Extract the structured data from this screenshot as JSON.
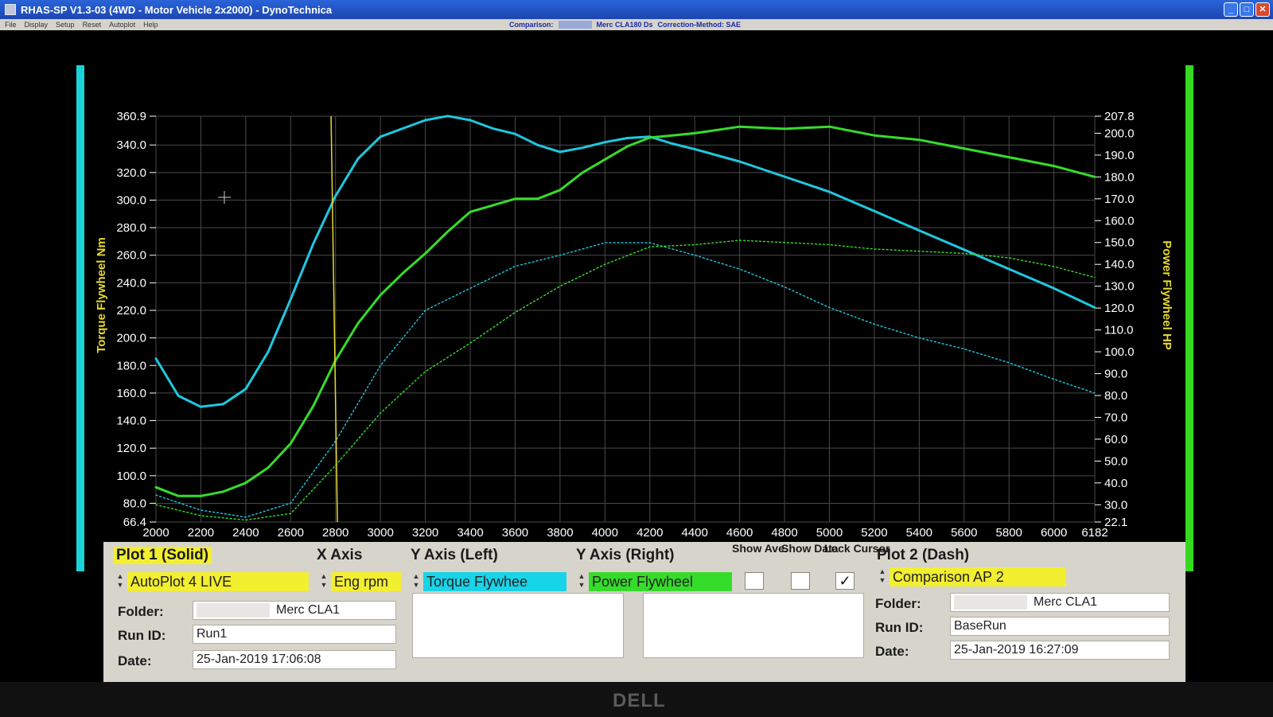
{
  "window": {
    "title": "RHAS-SP V1.3-03  (4WD - Motor Vehicle 2x2000) - DynoTechnica",
    "buttons": {
      "minimize": "_",
      "maximize": "□",
      "close": "✕"
    }
  },
  "menu": {
    "items": [
      "File",
      "Display",
      "Setup",
      "Reset",
      "Autoplot",
      "Help"
    ],
    "comparison_label": "Comparison:",
    "comparison_value": "Merc CLA180 Ds",
    "correction_method": "Correction-Method: SAE"
  },
  "colors": {
    "torque": "#1ec8e0",
    "power": "#36dc2a",
    "cursor": "#e6d830",
    "grid": "#4a4a4a",
    "axis_text": "#ffffff",
    "axis_title": "#e6d830"
  },
  "chart_data": {
    "type": "line",
    "x_label": "",
    "y_left_title": "Torque Flywheel Nm",
    "y_right_title": "Power Flywheel HP",
    "x_range": [
      2000,
      6182
    ],
    "x_ticks": [
      2000,
      2200,
      2400,
      2600,
      2800,
      3000,
      3200,
      3400,
      3600,
      3800,
      4000,
      4200,
      4400,
      4600,
      4800,
      5000,
      5200,
      5400,
      5600,
      5800,
      6000,
      6182
    ],
    "x_tick_labels": [
      "2000",
      "2200",
      "2400",
      "2600",
      "2800",
      "3000",
      "3200",
      "3400",
      "3600",
      "3800",
      "4000",
      "4200",
      "4400",
      "4600",
      "4800",
      "5000",
      "5200",
      "5400",
      "5600",
      "5800",
      "6000",
      "6182"
    ],
    "y_left_range": [
      66.4,
      360.9
    ],
    "y_left_ticks": [
      66.4,
      80,
      100,
      120,
      140,
      160,
      180,
      200,
      220,
      240,
      260,
      280,
      300,
      320,
      340,
      360.9
    ],
    "y_left_tick_labels": [
      "66.4",
      "80.0",
      "100.0",
      "120.0",
      "140.0",
      "160.0",
      "180.0",
      "200.0",
      "220.0",
      "240.0",
      "260.0",
      "280.0",
      "300.0",
      "320.0",
      "340.0",
      "360.9"
    ],
    "y_right_range": [
      22.1,
      207.8
    ],
    "y_right_ticks": [
      22.1,
      30,
      40,
      50,
      60,
      70,
      80,
      90,
      100,
      110,
      120,
      130,
      140,
      150,
      160,
      170,
      180,
      190,
      200,
      207.8
    ],
    "y_right_tick_labels": [
      "22.1",
      "30.0",
      "40.0",
      "50.0",
      "60.0",
      "70.0",
      "80.0",
      "90.0",
      "100.0",
      "110.0",
      "120.0",
      "130.0",
      "140.0",
      "150.0",
      "160.0",
      "170.0",
      "180.0",
      "190.0",
      "200.0",
      "207.8"
    ],
    "cursor_rpm": 2780,
    "series": [
      {
        "axis": "left",
        "style": "solid",
        "color": "#1ec8e0",
        "x": [
          2000,
          2100,
          2200,
          2300,
          2400,
          2500,
          2600,
          2700,
          2800,
          2900,
          3000,
          3100,
          3200,
          3300,
          3400,
          3500,
          3600,
          3700,
          3800,
          3900,
          4000,
          4100,
          4200,
          4300,
          4400,
          4600,
          4800,
          5000,
          5200,
          5400,
          5600,
          5800,
          6000,
          6182
        ],
        "y": [
          185,
          158,
          150,
          152,
          163,
          190,
          228,
          268,
          303,
          330,
          346,
          352,
          358,
          361,
          358,
          352,
          348,
          340,
          335,
          338,
          342,
          345,
          346,
          341,
          337,
          328,
          317,
          306,
          292,
          278,
          264,
          250,
          236,
          222
        ]
      },
      {
        "axis": "right",
        "style": "solid",
        "color": "#36dc2a",
        "x": [
          2000,
          2100,
          2200,
          2300,
          2400,
          2500,
          2600,
          2700,
          2800,
          2900,
          3000,
          3100,
          3200,
          3300,
          3400,
          3500,
          3600,
          3700,
          3800,
          3900,
          4000,
          4100,
          4200,
          4300,
          4400,
          4600,
          4800,
          5000,
          5200,
          5400,
          5600,
          5800,
          6000,
          6182
        ],
        "y": [
          38,
          34,
          34,
          36,
          40,
          47,
          58,
          75,
          96,
          113,
          126,
          136,
          145,
          155,
          164,
          167,
          170,
          170,
          174,
          182,
          188,
          194,
          198,
          199,
          200,
          203,
          202,
          203,
          199,
          197,
          193,
          189,
          185,
          180
        ]
      },
      {
        "axis": "left",
        "style": "dash",
        "color": "#1ec8e0",
        "x": [
          2000,
          2200,
          2400,
          2600,
          2800,
          3000,
          3200,
          3400,
          3600,
          3800,
          4000,
          4200,
          4400,
          4600,
          4800,
          5000,
          5200,
          5400,
          5600,
          5800,
          6000,
          6182
        ],
        "y": [
          86,
          75,
          70,
          80,
          125,
          180,
          220,
          236,
          252,
          260,
          269,
          269,
          260,
          250,
          237,
          222,
          210,
          200,
          192,
          182,
          170,
          160
        ]
      },
      {
        "axis": "right",
        "style": "dash",
        "color": "#36dc2a",
        "x": [
          2000,
          2200,
          2400,
          2600,
          2800,
          3000,
          3200,
          3400,
          3600,
          3800,
          4000,
          4200,
          4400,
          4600,
          4800,
          5000,
          5200,
          5400,
          5600,
          5800,
          6000,
          6182
        ],
        "y": [
          30,
          25,
          23,
          26,
          48,
          72,
          91,
          104,
          118,
          130,
          140,
          148,
          149,
          151,
          150,
          149,
          147,
          146,
          145,
          143,
          139,
          134
        ]
      }
    ]
  },
  "panel": {
    "plot1_title": "Plot 1 (Solid)",
    "x_axis_title": "X Axis",
    "y_left_title": "Y Axis (Left)",
    "y_right_title": "Y Axis (Right)",
    "show_ave": "Show Ave.",
    "show_data": "Show Data",
    "lock_cursor": "Lock Cursor",
    "plot2_title": "Plot 2 (Dash)",
    "plot1_source": "AutoPlot 4 LIVE",
    "x_axis_value": "Eng rpm",
    "y_left_value": "Torque Flywhee",
    "y_right_value": "Power Flywheel",
    "plot2_source": "Comparison AP 2",
    "lock_cursor_checked": "✓",
    "folder_label": "Folder:",
    "runid_label": "Run ID:",
    "date_label": "Date:",
    "plot1_folder": "Merc CLA1",
    "plot1_runid": "Run1",
    "plot1_date": "25-Jan-2019  17:06:08",
    "plot2_folder": "Merc CLA1",
    "plot2_runid": "BaseRun",
    "plot2_date": "25-Jan-2019  16:27:09"
  },
  "monitor": {
    "brand": "DELL"
  }
}
